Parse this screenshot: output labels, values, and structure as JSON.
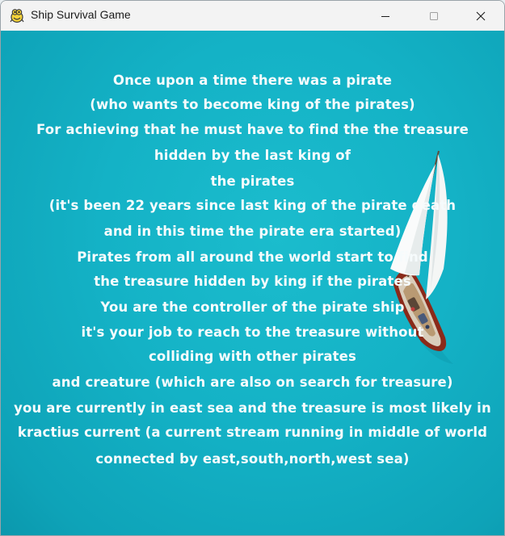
{
  "window": {
    "title": "Ship Survival Game",
    "app_icon": "pygame-snake-icon",
    "controls": [
      "minimize-icon",
      "maximize-icon",
      "close-icon"
    ]
  },
  "game": {
    "background_color": "#14b2c6",
    "text_color": "#f6fbfc",
    "story_lines": [
      "Once upon a time there was a pirate",
      "(who wants to become king of the pirates)",
      "For achieving that he must have to find the the treasure",
      "hidden by the last king of",
      "the pirates",
      "(it's been 22 years since last king of the pirate death",
      "and in this time the pirate era started)",
      "Pirates from all around the world start to find",
      "the treasure hidden by king if the pirates",
      "You are the controller of the pirate ship",
      "it's your job to reach to the treasure without",
      "colliding with other pirates",
      "and creature (which are also on search for treasure)",
      "you are currently in east sea and the treasure is most likely in",
      "kractius current (a current stream running in middle of world",
      "connected by east,south,north,west sea)"
    ]
  }
}
